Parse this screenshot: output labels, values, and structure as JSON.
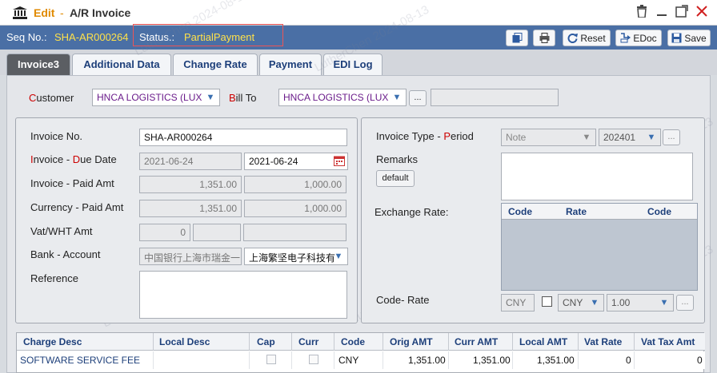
{
  "title": {
    "mode": "Edit",
    "separator": "-",
    "name": "A/R Invoice"
  },
  "header": {
    "seq_label": "Seq No.:",
    "seq_value": "SHA-AR000264",
    "status_label": "Status.:",
    "status_value": "PartialPayment"
  },
  "toolbar": {
    "reset": "Reset",
    "edoc": "EDoc",
    "save": "Save"
  },
  "tabs": [
    "Invoice3",
    "Additional Data",
    "Change Rate",
    "Payment",
    "EDI Log"
  ],
  "customer": {
    "customer_label_first": "C",
    "customer_label_rest": "ustomer",
    "customer_value": "HNCA LOGISTICS (LUX",
    "billto_label_first": "B",
    "billto_label_rest": "ill To",
    "billto_value": "HNCA LOGISTICS (LUX",
    "dots": "..."
  },
  "left": {
    "invoice_no_label": "Invoice No.",
    "invoice_no_value": "SHA-AR000264",
    "date_label_a": "I",
    "date_label_b": "nvoice - ",
    "date_label_c": "D",
    "date_label_d": "ue Date",
    "invoice_date": "2021-06-24",
    "due_date": "2021-06-24",
    "paid_label": "Invoice - Paid Amt",
    "invoice_amt": "1,351.00",
    "paid_amt": "1,000.00",
    "currency_label": "Currency - Paid Amt",
    "currency_amt": "1,351.00",
    "currency_paid_amt": "1,000.00",
    "vat_label": "Vat/WHT Amt",
    "vat_value": "0",
    "bank_label": "Bank - Account",
    "bank_value": "中国银行上海市瑞金一",
    "account_value": "上海繁坚电子科技有",
    "reference_label": "Reference"
  },
  "right": {
    "invtype_label_a": "Invoice Type - ",
    "invtype_label_b": "P",
    "invtype_label_c": "eriod",
    "invtype_value": "Note",
    "period_value": "202401",
    "remarks_label": "Remarks",
    "default_button": "default",
    "exrate_label": "Exchange Rate:",
    "ex_cols": [
      "Code",
      "Rate",
      "Code"
    ],
    "coderate_label": "Code- Rate",
    "code_value": "CNY",
    "code2_value": "CNY",
    "rate_value": "1.00"
  },
  "grid": {
    "columns": [
      "Charge Desc",
      "Local Desc",
      "Cap",
      "Curr",
      "Code",
      "Orig AMT",
      "Curr AMT",
      "Local AMT",
      "Vat Rate",
      "Vat Tax Amt"
    ],
    "rows": [
      {
        "charge_desc": "SOFTWARE SERVICE FEE",
        "local_desc": "",
        "code": "CNY",
        "orig_amt": "1,351.00",
        "curr_amt": "1,351.00",
        "local_amt": "1,351.00",
        "vat_rate": "0",
        "vat_tax_amt": "0"
      }
    ]
  },
  "watermark": "LutherChen 2024-08-13",
  "colors": {
    "accent": "#4a6fa5",
    "status": "#ffe14a",
    "edit": "#e08a00",
    "required": "#cc0000",
    "tab_active": "#5b5e63"
  }
}
